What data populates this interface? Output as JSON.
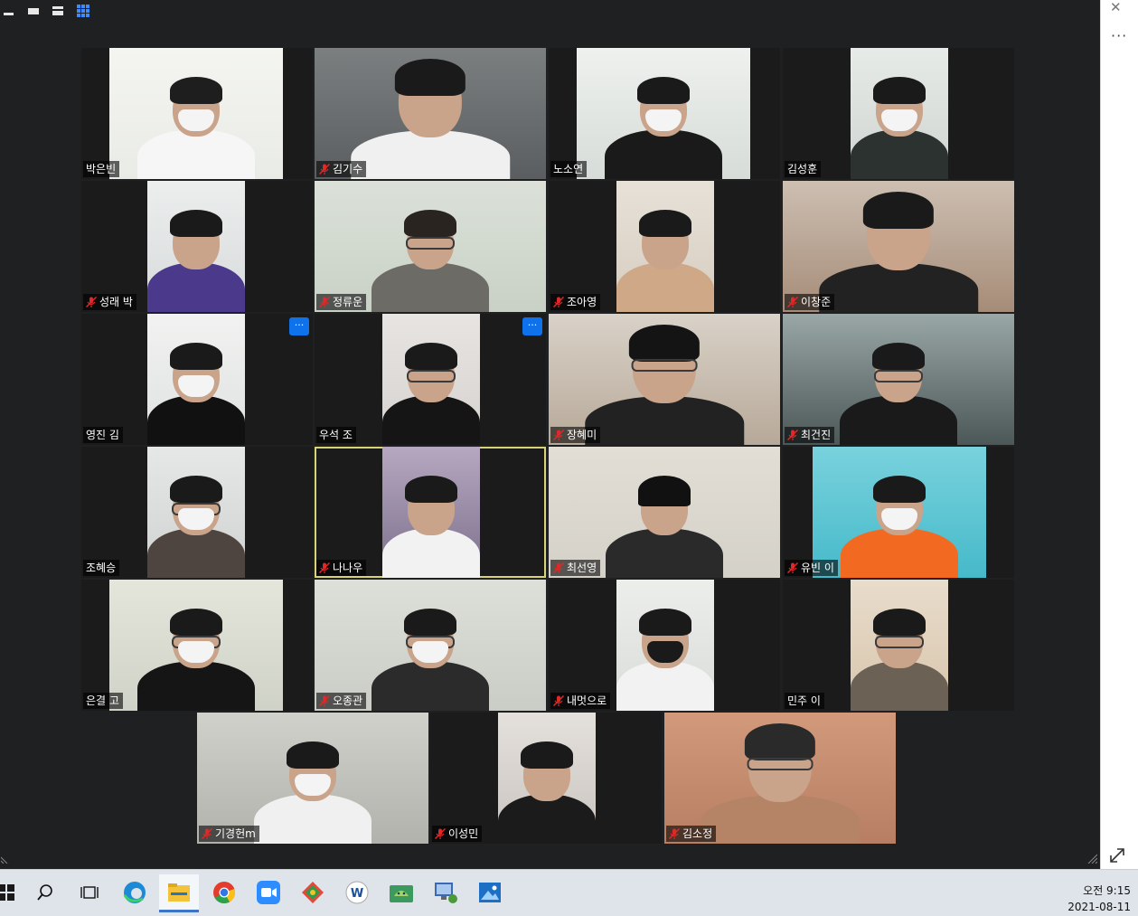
{
  "window": {
    "icons": {
      "minimize": "minimize-icon",
      "speaker_view": "speaker-view-icon",
      "strip_view": "strip-view-icon",
      "gallery_view": "gallery-grid-icon"
    },
    "close_glyph": "✕",
    "more_glyph": "···"
  },
  "colors": {
    "background": "#1f2022",
    "active_speaker_border": "#d8d377",
    "mute_icon": "#e02828",
    "more_button": "#0e72ed"
  },
  "participants": [
    {
      "name": "박은빈",
      "muted": false
    },
    {
      "name": "김기수",
      "muted": true
    },
    {
      "name": "노소연",
      "muted": false
    },
    {
      "name": "김성훈",
      "muted": false
    },
    {
      "name": "성래 박",
      "muted": true
    },
    {
      "name": "정류운",
      "muted": true
    },
    {
      "name": "조아영",
      "muted": true
    },
    {
      "name": "이창준",
      "muted": true
    },
    {
      "name": "영진 김",
      "muted": false,
      "more": "···"
    },
    {
      "name": "우석 조",
      "muted": false,
      "more": "···"
    },
    {
      "name": "장혜미",
      "muted": true
    },
    {
      "name": "최건진",
      "muted": true
    },
    {
      "name": "조혜승",
      "muted": false
    },
    {
      "name": "나나우",
      "muted": true,
      "active_speaker": true
    },
    {
      "name": "최선영",
      "muted": true
    },
    {
      "name": "유빈 이",
      "muted": true
    },
    {
      "name": "은결 고",
      "muted": false
    },
    {
      "name": "오종관",
      "muted": true
    },
    {
      "name": "내멋으로",
      "muted": true
    },
    {
      "name": "민주 이",
      "muted": false
    },
    {
      "name": "기경헌m",
      "muted": true
    },
    {
      "name": "이성민",
      "muted": true
    },
    {
      "name": "김소정",
      "muted": true
    }
  ],
  "taskbar": {
    "apps": [
      "windows-start-icon",
      "search-icon",
      "task-view-icon",
      "edge-icon",
      "file-explorer-icon",
      "chrome-icon",
      "zoom-icon",
      "git-icon",
      "word-icon",
      "android-studio-icon",
      "network-tool-icon",
      "photos-icon"
    ],
    "time": "오전 9:15",
    "date": "2021-08-11"
  }
}
